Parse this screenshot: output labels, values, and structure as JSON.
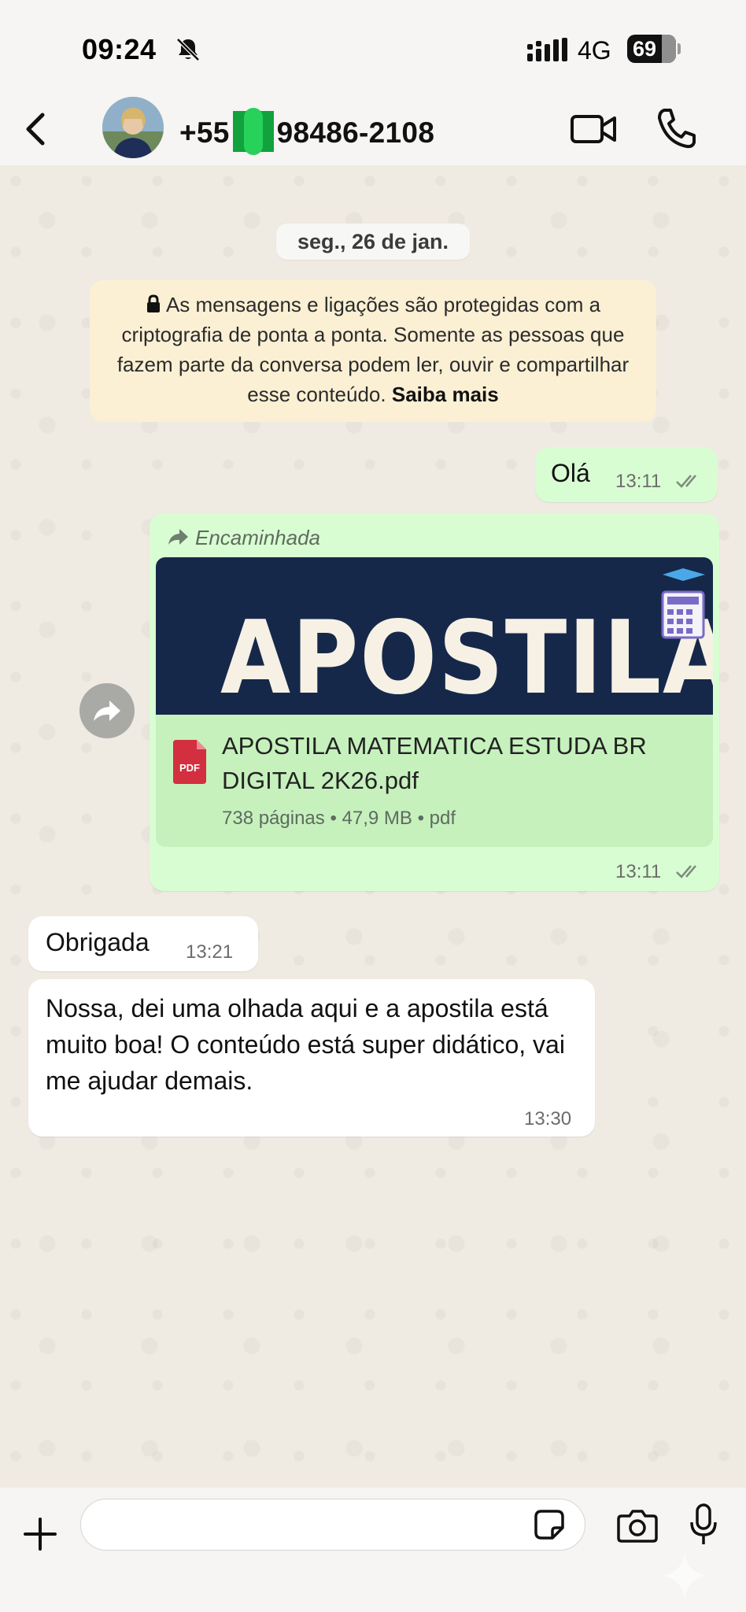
{
  "status_bar": {
    "time": "09:24",
    "network": "4G",
    "battery": "69",
    "icons": [
      "bell-muted-icon",
      "signal-icon",
      "battery-icon"
    ]
  },
  "header": {
    "contact_prefix": "+55",
    "contact_suffix": "98486-2108",
    "icons": [
      "back-icon",
      "video-call-icon",
      "phone-icon"
    ]
  },
  "chat": {
    "date_chip": "seg., 26 de jan.",
    "encryption_notice": {
      "text": "As mensagens e ligações são protegidas com a criptografia de ponta a ponta. Somente as pessoas que fazem parte da conversa podem ler, ouvir e compartilhar esse conteúdo.",
      "link": "Saiba mais"
    },
    "messages": [
      {
        "direction": "outgoing",
        "type": "text",
        "text": "Olá",
        "time": "13:11",
        "status": "read"
      },
      {
        "direction": "outgoing",
        "type": "document",
        "forwarded_label": "Encaminhada",
        "thumbnail_text": "APOSTILA",
        "file_name": "APOSTILA MATEMATICA ESTUDA BR DIGITAL 2K26.pdf",
        "file_meta": "738 páginas • 47,9 MB • pdf",
        "file_icon_label": "PDF",
        "time": "13:11",
        "status": "read"
      },
      {
        "direction": "incoming",
        "type": "text",
        "text": "Obrigada",
        "time": "13:21"
      },
      {
        "direction": "incoming",
        "type": "text",
        "text": "Nossa, dei uma olhada aqui e a apostila está muito boa!  O conteúdo está super didático, vai me ajudar demais.",
        "time": "13:30"
      }
    ]
  },
  "input_bar": {
    "placeholder": "",
    "icons": [
      "plus-icon",
      "sticker-icon",
      "camera-icon",
      "microphone-icon"
    ]
  },
  "colors": {
    "outgoing_bubble": "#d9fdd3",
    "incoming_bubble": "#ffffff",
    "doc_thumbnail_bg": "#16284a",
    "encryption_notice_bg": "#fbf0d4",
    "chat_background": "#efeae2"
  }
}
